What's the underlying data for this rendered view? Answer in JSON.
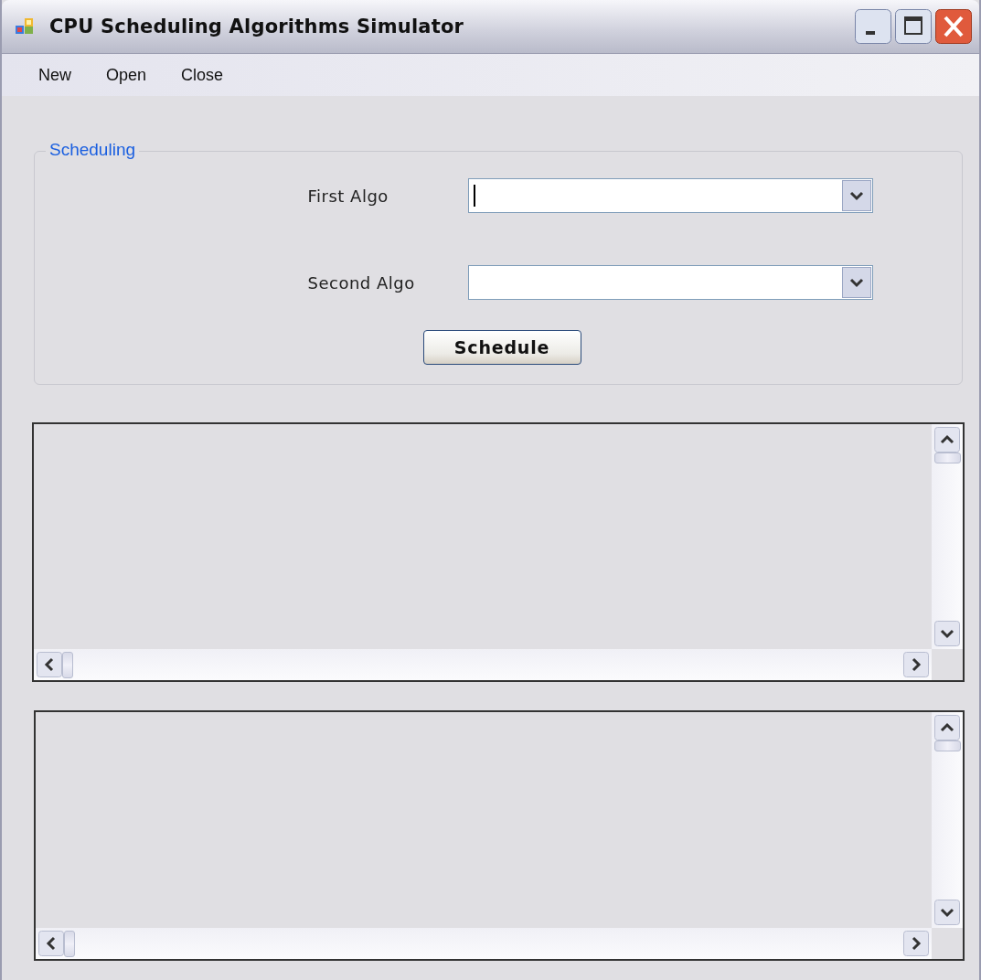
{
  "window": {
    "title": "CPU Scheduling Algorithms Simulator"
  },
  "menu": [
    "New",
    "Open",
    "Close"
  ],
  "scheduling": {
    "title": "Scheduling",
    "fields": [
      {
        "label": "First Algo",
        "focused": true
      },
      {
        "label": "Second Algo",
        "focused": false
      }
    ],
    "button": "Schedule"
  },
  "panels": [
    {
      "kind": "scroll_panel"
    },
    {
      "kind": "scroll_panel"
    }
  ]
}
